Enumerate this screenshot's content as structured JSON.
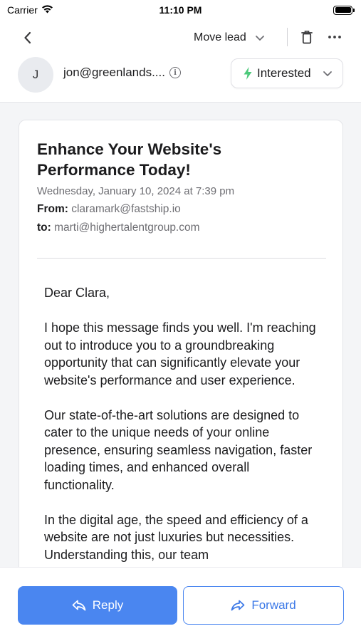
{
  "status_bar": {
    "carrier": "Carrier",
    "time": "11:10 PM"
  },
  "nav": {
    "move_lead_label": "Move lead"
  },
  "contact": {
    "avatar_initial": "J",
    "email": "jon@greenlands....",
    "status_label": "Interested",
    "status_color": "#34c759"
  },
  "email": {
    "subject": "Enhance Your Website's Performance Today!",
    "date": "Wednesday, January 10, 2024 at 7:39 pm",
    "from_label": "From:",
    "from_value": "claramark@fastship.io",
    "to_label": "to:",
    "to_value": "marti@highertalentgroup.com",
    "body": {
      "greeting": "Dear Clara,",
      "paragraph_1": "I hope this message finds you well. I'm reaching out to introduce you to a groundbreaking opportunity that can significantly elevate your website's performance and user experience.",
      "paragraph_2": "Our state-of-the-art solutions are designed to cater to the unique needs of your online presence, ensuring seamless navigation, faster loading times, and enhanced overall functionality.",
      "paragraph_3": "In the digital age, the speed and efficiency of a website are not just luxuries but necessities. Understanding this, our team"
    }
  },
  "actions": {
    "reply_label": "Reply",
    "forward_label": "Forward",
    "accent_color": "#4a86f0"
  }
}
